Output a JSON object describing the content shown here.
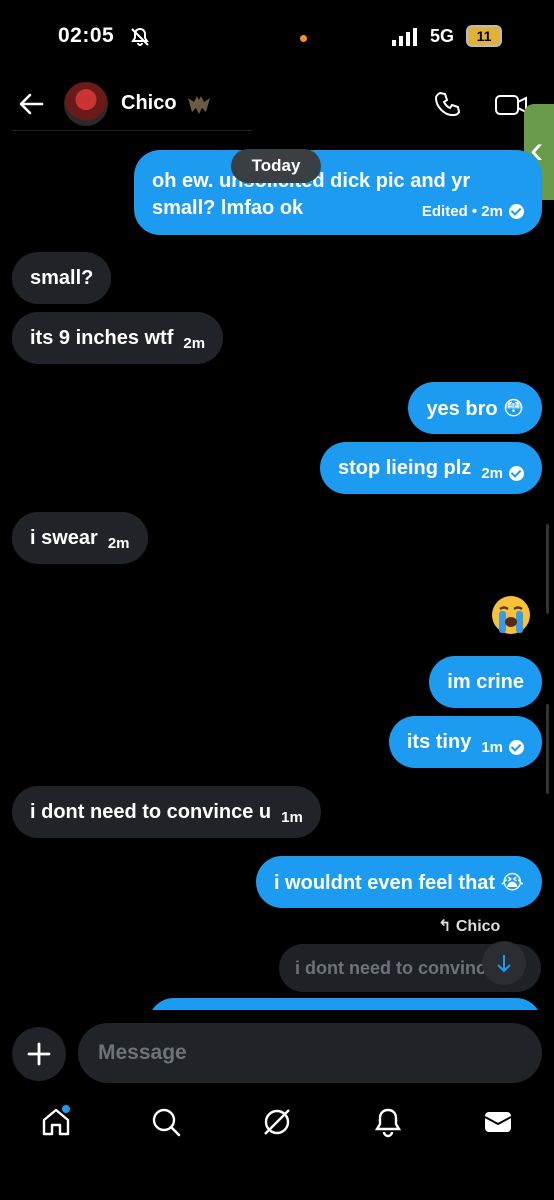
{
  "status": {
    "time": "02:05",
    "network": "5G",
    "battery": "11"
  },
  "header": {
    "contact_name": "Chico"
  },
  "date_chip": "Today",
  "messages": [
    {
      "dir": "out",
      "line1": "oh ew. unsolicited dick pic and yr",
      "line2": "small? lmfao ok",
      "meta": "Edited • 2m"
    },
    {
      "dir": "in",
      "text": "small?"
    },
    {
      "dir": "in",
      "text": "its 9 inches wtf",
      "time": "2m"
    },
    {
      "dir": "out",
      "text": "yes bro 😳"
    },
    {
      "dir": "out",
      "text": "stop lieing plz",
      "time": "2m"
    },
    {
      "dir": "in",
      "text": "i swear",
      "time": "2m"
    },
    {
      "dir": "out",
      "text": "im crine"
    },
    {
      "dir": "out",
      "text": "its tiny",
      "time": "1m"
    },
    {
      "dir": "in",
      "text": "i dont need to convince u",
      "time": "1m"
    },
    {
      "dir": "out",
      "text": "i wouldnt even feel that 😭"
    }
  ],
  "reply": {
    "label": "Chico",
    "quoted": "i dont need to convince u"
  },
  "composer": {
    "placeholder": "Message"
  },
  "accent": "#1d9bf0"
}
